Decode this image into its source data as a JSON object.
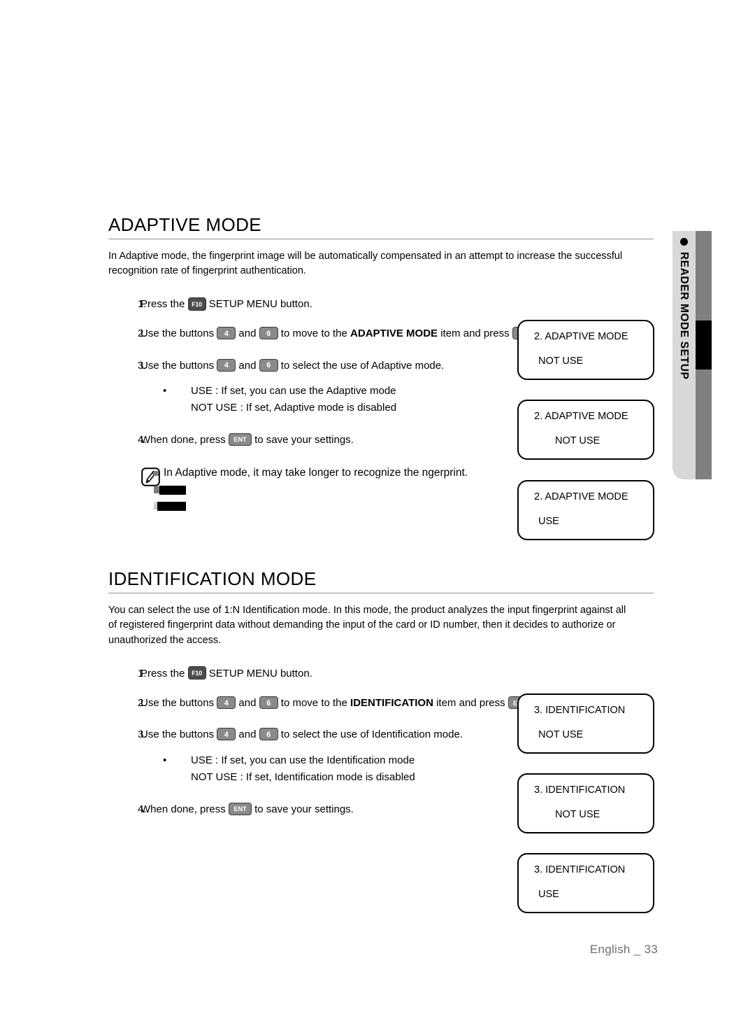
{
  "side_tab": {
    "label": "READER MODE SETUP",
    "bullet_icon": "filled-circle-icon"
  },
  "sections": [
    {
      "id": "adaptive",
      "title": "ADAPTIVE MODE",
      "intro": "In Adaptive mode, the fingerprint image will be automatically compensated in an attempt to increase the successful recognition rate of fingerprint authentication.",
      "steps": {
        "s1_num": "1.",
        "s1_a": "Press the",
        "s1_key": "F10",
        "s1_b": "SETUP MENU button.",
        "s2_num": "2.",
        "s2_a": "Use the buttons",
        "s2_key_left": "4",
        "s2_and": "and",
        "s2_key_right": "6",
        "s2_b": "to move to the",
        "s2_bold": "ADAPTIVE MODE",
        "s2_c": "item and press",
        "s2_key_ent": "ENT",
        "s2_d": ".",
        "s3_num": "3.",
        "s3_a": "Use the buttons",
        "s3_key_left": "4",
        "s3_and": "and",
        "s3_key_right": "6",
        "s3_b": "to select the use of Adaptive mode.",
        "bullet": "•",
        "bullet_line1": "USE : If set, you can use the Adaptive mode",
        "bullet_line2": "NOT USE : If set, Adaptive mode is disabled",
        "s4_num": "4.",
        "s4_a": "When done, press",
        "s4_key_ent": "ENT",
        "s4_b": "to save your settings."
      },
      "note": {
        "icon": "note-pen-icon",
        "marker": "square-bullet",
        "text": "In Adaptive mode, it may take longer to recognize the  ngerprint.",
        "redacted_1": "",
        "redacted_2": ""
      },
      "screens": [
        {
          "title": "2. ADAPTIVE MODE",
          "value": "NOT USE",
          "indent": false
        },
        {
          "title": "2. ADAPTIVE MODE",
          "value": "NOT USE",
          "indent": true
        },
        {
          "title": "2. ADAPTIVE MODE",
          "value": "USE",
          "indent": false
        }
      ]
    },
    {
      "id": "identification",
      "title": "IDENTIFICATION MODE",
      "intro": "You can select the use of 1:N Identification mode. In this mode, the product analyzes the input fingerprint against all of registered fingerprint data without demanding the input of the card or ID number, then it decides to authorize or unauthorized the access.",
      "steps": {
        "s1_num": "1.",
        "s1_a": "Press the",
        "s1_key": "F10",
        "s1_b": "SETUP MENU button.",
        "s2_num": "2.",
        "s2_a": "Use the buttons",
        "s2_key_left": "4",
        "s2_and": "and",
        "s2_key_right": "6",
        "s2_b": "to move to the",
        "s2_bold": "IDENTIFICATION",
        "s2_c": "item and press",
        "s2_key_ent": "ENT",
        "s2_d": ".",
        "s3_num": "3.",
        "s3_a": "Use the buttons",
        "s3_key_left": "4",
        "s3_and": "and",
        "s3_key_right": "6",
        "s3_b": "to select the use of Identification mode.",
        "bullet": "•",
        "bullet_line1": "USE : If set, you can use the Identification mode",
        "bullet_line2": "NOT USE : If set, Identification mode is disabled",
        "s4_num": "4.",
        "s4_a": "When done, press",
        "s4_key_ent": "ENT",
        "s4_b": "to save your settings."
      },
      "screens": [
        {
          "title": "3. IDENTIFICATION",
          "value": "NOT USE",
          "indent": false
        },
        {
          "title": "3. IDENTIFICATION",
          "value": "NOT USE",
          "indent": true
        },
        {
          "title": "3. IDENTIFICATION",
          "value": "USE",
          "indent": false
        }
      ]
    }
  ],
  "footer": {
    "language": "English _",
    "page_number": "33"
  },
  "colors": {
    "tab_light": "#d8d8d8",
    "tab_dark": "#808080",
    "tab_marker": "#000000",
    "rule": "#909090",
    "footer_text": "#6e6e6e",
    "key_dark": "#4d4d4d",
    "key_gray": "#8a8a8a"
  }
}
